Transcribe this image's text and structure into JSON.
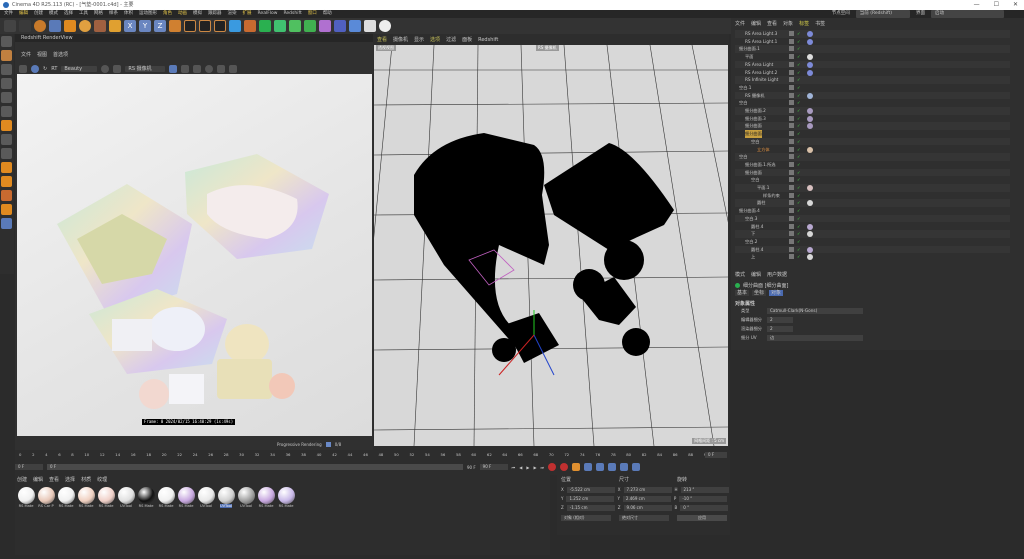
{
  "window": {
    "title": "Cinema 4D R25.113 (RC) - [气垫-0001.c4d] - 主要",
    "controls": [
      "—",
      "☐",
      "✕"
    ]
  },
  "menu": {
    "items": [
      {
        "label": "文件"
      },
      {
        "label": "编辑",
        "hl": true
      },
      {
        "label": "创建"
      },
      {
        "label": "模式"
      },
      {
        "label": "选择"
      },
      {
        "label": "工具"
      },
      {
        "label": "网格"
      },
      {
        "label": "样条"
      },
      {
        "label": "体积"
      },
      {
        "label": "运动图形"
      },
      {
        "label": "角色",
        "hl": true
      },
      {
        "label": "动画",
        "hl": true
      },
      {
        "label": "模拟"
      },
      {
        "label": "跟踪器"
      },
      {
        "label": "渲染"
      },
      {
        "label": "扩展",
        "hl": true
      },
      {
        "label": "RealFlow"
      },
      {
        "label": "Redshift"
      },
      {
        "label": "窗口",
        "hl": true
      },
      {
        "label": "帮助"
      }
    ],
    "node_space_label": "节点空间",
    "node_space_value": "当前 (Redshift)",
    "layout_label": "界面",
    "layout_value": "启动"
  },
  "toolbar": {
    "axis_labels": [
      "X",
      "Y",
      "Z"
    ]
  },
  "render_view": {
    "tab": "Redshift RenderView",
    "menu": [
      "文件",
      "视图",
      "首选项"
    ],
    "preset": "Beauty",
    "camera": "RS 摄像机",
    "stamp": "Frame: 0  2024/02/15  16:40:29  (1s:49s)",
    "progressive": "Progressive Rendering",
    "progressive_value": "0/8"
  },
  "viewport": {
    "menu": [
      {
        "label": "查看",
        "hl": true
      },
      {
        "label": "摄像机"
      },
      {
        "label": "显示"
      },
      {
        "label": "选项",
        "hl": true
      },
      {
        "label": "过滤"
      },
      {
        "label": "面板"
      },
      {
        "label": "Redshift"
      }
    ],
    "view_label": "透视视图",
    "camera_label": "RS 摄像机",
    "grid_label": "网格间距 : 5 cm"
  },
  "object_manager": {
    "menu": [
      {
        "label": "文件"
      },
      {
        "label": "编辑"
      },
      {
        "label": "查看"
      },
      {
        "label": "对象"
      },
      {
        "label": "标签",
        "hl": true
      },
      {
        "label": "书签"
      }
    ],
    "objects": [
      {
        "name": "RS Area Light.3",
        "indent": 1,
        "tag": "#7d8ad8"
      },
      {
        "name": "RS Area Light.1",
        "indent": 1,
        "tag": "#7d8ad8"
      },
      {
        "name": "细分曲面.1",
        "indent": 0,
        "tag": ""
      },
      {
        "name": "平面",
        "indent": 1,
        "tag": "#dddddd"
      },
      {
        "name": "RS Area Light",
        "indent": 1,
        "tag": "#7d8ad8"
      },
      {
        "name": "RS Area Light.2",
        "indent": 1,
        "tag": "#7d8ad8"
      },
      {
        "name": "RS Infinite Light",
        "indent": 1,
        "tag": ""
      },
      {
        "name": "空白.1",
        "indent": 0,
        "tag": ""
      },
      {
        "name": "RS 摄像机",
        "indent": 1,
        "tag": "#a0b4d8"
      },
      {
        "name": "空白",
        "indent": 0,
        "tag": ""
      },
      {
        "name": "细分曲面.2",
        "indent": 1,
        "tag": "#a89ac0"
      },
      {
        "name": "细分曲面.3",
        "indent": 1,
        "tag": "#a89ac0"
      },
      {
        "name": "细分曲面",
        "indent": 1,
        "tag": "#a89ac0"
      },
      {
        "name": "细分曲面",
        "indent": 1,
        "tag": "",
        "selected": true
      },
      {
        "name": "空白",
        "indent": 2,
        "tag": ""
      },
      {
        "name": "立方体",
        "indent": 3,
        "tag": "#d8c0a8",
        "orange": true
      },
      {
        "name": "空白",
        "indent": 0,
        "tag": ""
      },
      {
        "name": "细分曲面.1.所选",
        "indent": 1,
        "tag": ""
      },
      {
        "name": "细分曲面",
        "indent": 1,
        "tag": ""
      },
      {
        "name": "空白",
        "indent": 2,
        "tag": ""
      },
      {
        "name": "平面.1",
        "indent": 3,
        "tag": "#d8c0c0"
      },
      {
        "name": "样条约束",
        "indent": 4,
        "tag": ""
      },
      {
        "name": "圆柱",
        "indent": 3,
        "tag": "#d8d8d8"
      },
      {
        "name": "细分曲面.4",
        "indent": 0,
        "tag": ""
      },
      {
        "name": "空白.3",
        "indent": 1,
        "tag": ""
      },
      {
        "name": "圆柱.4",
        "indent": 2,
        "tag": "#b8a8d0"
      },
      {
        "name": "下",
        "indent": 2,
        "tag": "#d8d8d8"
      },
      {
        "name": "空白.2",
        "indent": 1,
        "tag": ""
      },
      {
        "name": "圆柱.4",
        "indent": 2,
        "tag": "#b8a8d0"
      },
      {
        "name": "上",
        "indent": 2,
        "tag": "#d8d8d8"
      }
    ]
  },
  "attributes": {
    "menu": [
      "模式",
      "编辑",
      "用户数据"
    ],
    "object": "细分曲面 [细分曲面]",
    "tabs": [
      {
        "label": "基本"
      },
      {
        "label": "坐标"
      },
      {
        "label": "对象",
        "active": true
      }
    ],
    "section": "对象属性",
    "fields": [
      {
        "label": "类型",
        "value": "Catmull-Clark(N-Gons)",
        "select": true
      },
      {
        "label": "编辑器细分",
        "value": "2"
      },
      {
        "label": "渲染器细分",
        "value": "2"
      },
      {
        "label": "细分 UV",
        "value": "边",
        "select": true
      }
    ]
  },
  "timeline": {
    "ticks": [
      "0",
      "2",
      "4",
      "6",
      "8",
      "10",
      "12",
      "14",
      "16",
      "18",
      "20",
      "22",
      "24",
      "26",
      "28",
      "30",
      "32",
      "34",
      "36",
      "38",
      "40",
      "42",
      "44",
      "46",
      "48",
      "50",
      "52",
      "54",
      "56",
      "58",
      "60",
      "62",
      "64",
      "66",
      "68",
      "70",
      "72",
      "74",
      "76",
      "78",
      "80",
      "82",
      "84",
      "86",
      "88",
      "90"
    ],
    "current": "0 F",
    "start": "0 F",
    "range_start": "0 F",
    "range_end": "90 F",
    "end": "90 F",
    "end_field": "0 F"
  },
  "materials": {
    "menu": [
      "创建",
      "编辑",
      "查看",
      "选择",
      "材质",
      "纹理"
    ],
    "items": [
      {
        "label": "RS Mate",
        "color": "#f0f0f0"
      },
      {
        "label": "RS Car P",
        "color": "#e8c8b8"
      },
      {
        "label": "RS Mate",
        "color": "#f0f0f0"
      },
      {
        "label": "RS Mate",
        "color": "#f0d0c0"
      },
      {
        "label": "RS Mate",
        "color": "#f0d0c8"
      },
      {
        "label": "UVTool",
        "color": "#e0e0e0"
      },
      {
        "label": "RS Mate",
        "color": "#111111"
      },
      {
        "label": "RS Mate",
        "color": "#f0f0f0"
      },
      {
        "label": "RS Mate",
        "color": "#c8a8e0"
      },
      {
        "label": "UVTool",
        "color": "#e8e8e8"
      },
      {
        "label": "UVTool",
        "color": "#d0d0d0",
        "selected": true
      },
      {
        "label": "UVTool",
        "color": "#a0a0a0"
      },
      {
        "label": "RS Mate",
        "color": "#c8a8e0"
      },
      {
        "label": "RS Mate",
        "color": "#c8b8e8"
      }
    ]
  },
  "coordinates": {
    "headers": [
      "位置",
      "尺寸",
      "旋转"
    ],
    "rows": [
      {
        "a": "X",
        "av": "-5.522 cm",
        "b": "X",
        "bv": "7.273 cm",
        "c": "H",
        "cv": "213 °"
      },
      {
        "a": "Y",
        "av": "1.252 cm",
        "b": "Y",
        "bv": "2.469 cm",
        "c": "P",
        "cv": "-10 °"
      },
      {
        "a": "Z",
        "av": "-1.15 cm",
        "b": "Z",
        "bv": "9.06 cm",
        "c": "B",
        "cv": "0 °"
      }
    ],
    "mode": "对象 (相对)",
    "size_mode": "绝对尺寸",
    "apply": "应用"
  }
}
